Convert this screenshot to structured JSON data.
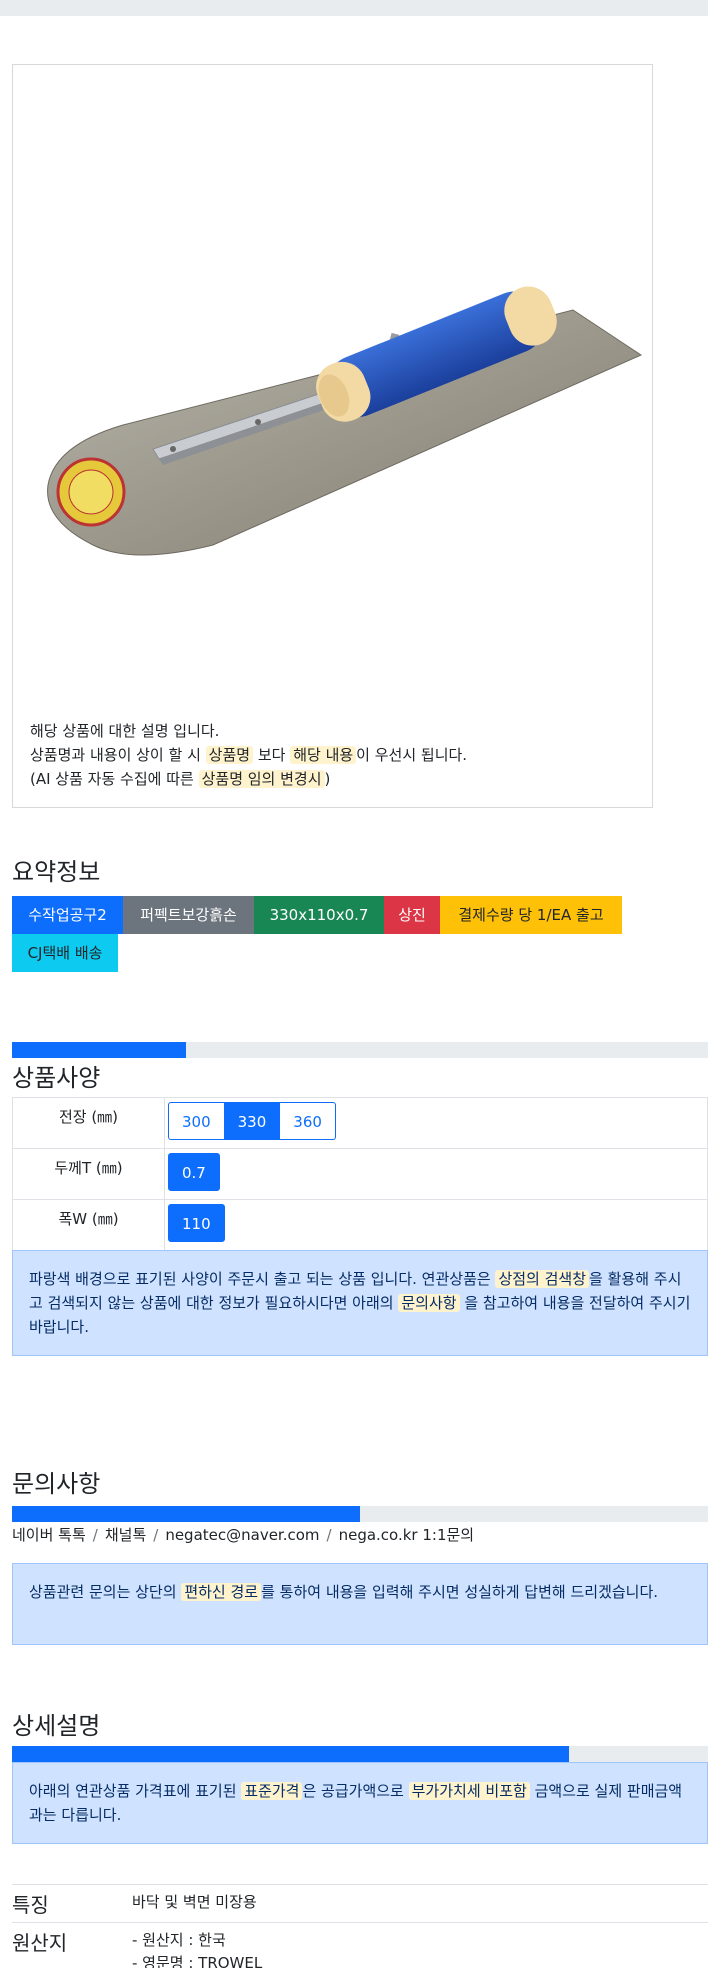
{
  "image_card": {
    "desc_line1": "해당 상품에 대한 설명 입니다.",
    "desc_line2_a": "상품명과 내용이 상이 할 시 ",
    "desc_line2_hl1": "상품명",
    "desc_line2_b": " 보다 ",
    "desc_line2_hl2": "해당 내용",
    "desc_line2_c": "이 우선시 됩니다.",
    "desc_line3_a": "(AI 상품 자동 수집에 따른 ",
    "desc_line3_hl": "상품명 임의 변경시",
    "desc_line3_b": ")"
  },
  "summary": {
    "title": "요약정보",
    "badges": [
      {
        "label": "수작업공구2",
        "color": "#0d6efd"
      },
      {
        "label": "퍼펙트보강흙손",
        "color": "#6c757d"
      },
      {
        "label": "330x110x0.7",
        "color": "#198754"
      },
      {
        "label": "상진",
        "color": "#dc3545"
      },
      {
        "label": "결제수량 당 1/EA 출고",
        "color": "#ffc107"
      },
      {
        "label": "CJ택배 배송",
        "color": "#0dcaf0"
      }
    ]
  },
  "spec": {
    "title": "상품사양",
    "progress": 25,
    "rows": [
      {
        "label": "전장 (㎜)",
        "options": [
          "300",
          "330",
          "360"
        ],
        "selected": "330"
      },
      {
        "label": "두께T (㎜)",
        "options": [
          "0.7"
        ],
        "selected": "0.7"
      },
      {
        "label": "폭W (㎜)",
        "options": [
          "110"
        ],
        "selected": "110"
      }
    ],
    "notice_a": "파랑색 배경으로 표기된 사양이 주문시 출고 되는 상품 입니다. 연관상품은 ",
    "notice_hl1": "상점의 검색창",
    "notice_b": "을 활용해 주시고 검색되지 않는 상품에 대한 정보가 필요하시다면 아래의 ",
    "notice_hl2": "문의사항",
    "notice_c": " 을 참고하여 내용을 전달하여 주시기 바랍니다."
  },
  "inquiry": {
    "title": "문의사항",
    "progress": 50,
    "links": [
      "네이버 톡톡",
      "채널톡",
      "negatec@naver.com",
      "nega.co.kr 1:1문의"
    ],
    "separator": "/",
    "notice_a": "상품관련 문의는 상단의 ",
    "notice_hl": "편하신 경로",
    "notice_b": "를 통하여 내용을 입력해 주시면 성실하게 답변해 드리겠습니다."
  },
  "detail": {
    "title": "상세설명",
    "progress": 80,
    "notice_a": "아래의 연관상품 가격표에 표기된 ",
    "notice_hl1": "표준가격",
    "notice_b": "은 공급가액으로 ",
    "notice_hl2": "부가가치세 비포함",
    "notice_c": " 금액으로 실제 판매금액과는 다릅니다.",
    "rows": [
      {
        "key": "특징",
        "lines": [
          "바닥 및 벽면 미장용"
        ]
      },
      {
        "key": "원산지",
        "lines": [
          "- 원산지 : 한국",
          "- 영문명 : TROWEL"
        ]
      }
    ]
  }
}
